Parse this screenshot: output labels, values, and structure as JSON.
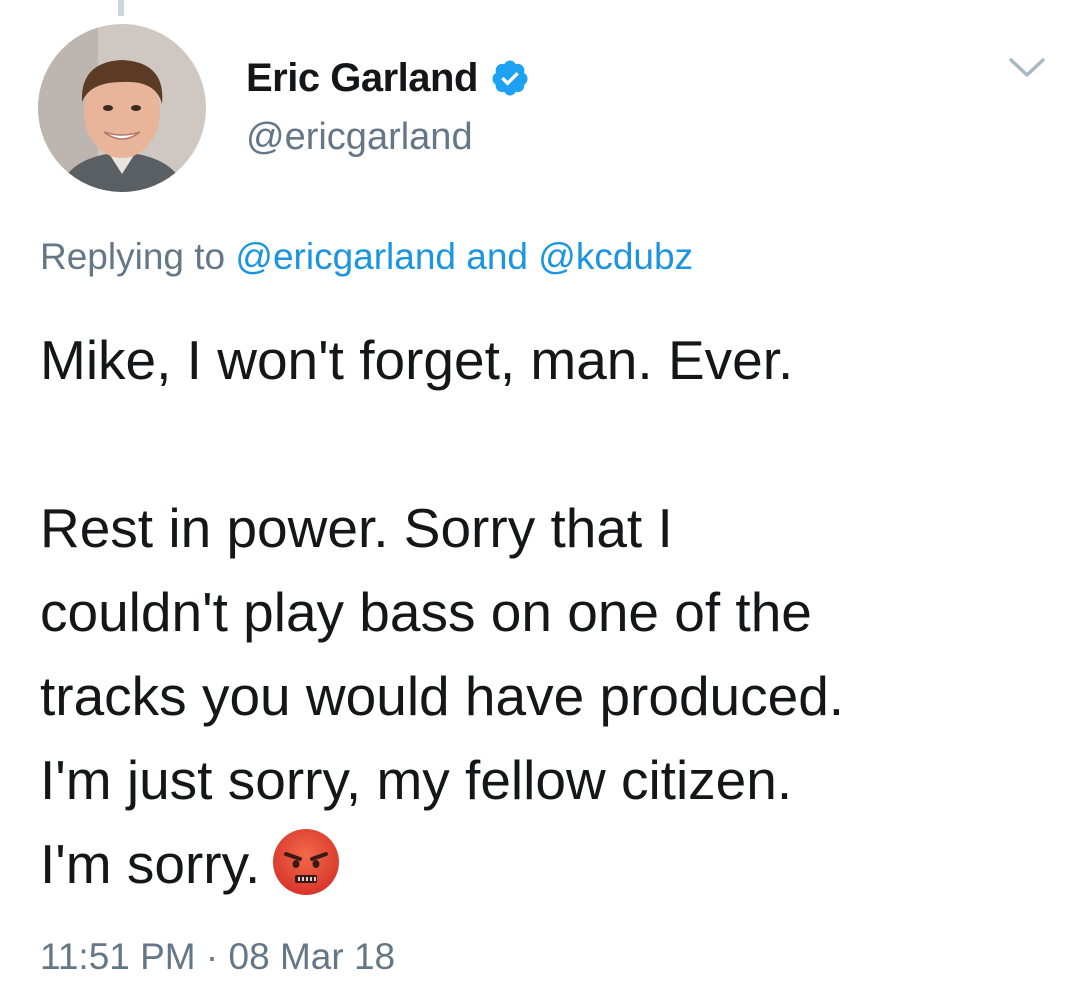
{
  "author": {
    "display_name": "Eric Garland",
    "handle": "@ericgarland",
    "verified": true
  },
  "reply": {
    "prefix": "Replying to ",
    "mention_1": "@ericgarland",
    "conjunction": " and ",
    "mention_2": "@kcdubz"
  },
  "tweet": {
    "paragraph_1": "Mike, I won't forget, man. Ever.",
    "paragraph_2_lines": [
      "Rest in power. Sorry that I",
      "couldn't play bass on one of the",
      "tracks you would have produced.",
      "I'm just sorry, my fellow citizen.",
      "I'm sorry."
    ],
    "emoji": "pouting-face-emoji"
  },
  "meta": {
    "time": "11:51 PM",
    "separator": " · ",
    "date": "08 Mar 18"
  },
  "colors": {
    "text": "#14171a",
    "secondary": "#657786",
    "link": "#1b95e0",
    "verified": "#1da1f2",
    "emoji_red": "#e0402a"
  },
  "icons": [
    "verified-badge-icon",
    "chevron-down-icon"
  ]
}
